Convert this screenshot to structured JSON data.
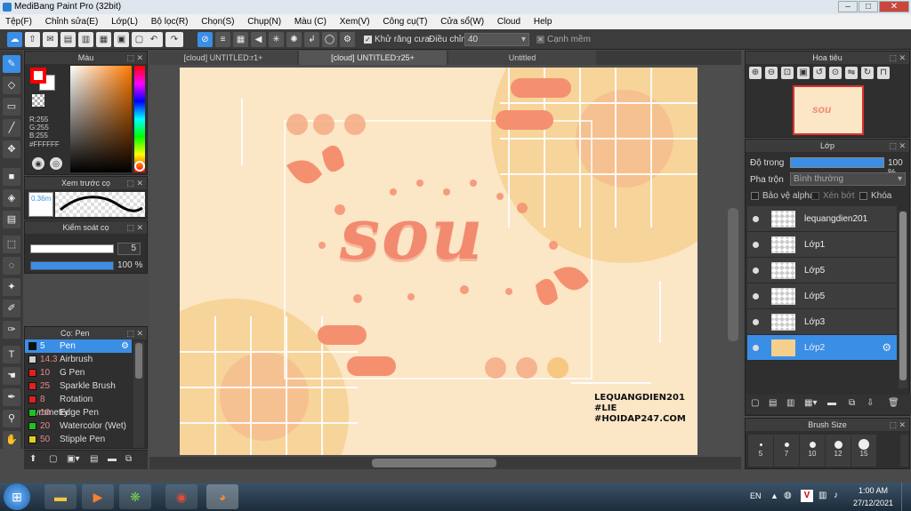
{
  "window": {
    "title": "MediBang Paint Pro (32bit)"
  },
  "menu": [
    "Tệp(F)",
    "Chỉnh sửa(E)",
    "Lớp(L)",
    "Bộ lọc(R)",
    "Chọn(S)",
    "Chụp(N)",
    "Màu (C)",
    "Xem(V)",
    "Công cụ(T)",
    "Cửa sổ(W)",
    "Cloud",
    "Help"
  ],
  "toolbar": {
    "antialias_label": "Khử răng cưa",
    "adjust_label": "Điều chỉnh",
    "adjust_value": "40",
    "sharp_label": "Cạnh mềm"
  },
  "tabs": [
    "[cloud] UNTITLED:r1+",
    "[cloud] UNTITLED:r25+",
    "Untitled"
  ],
  "color_panel": {
    "title": "Màu",
    "r": "R:255",
    "g": "G:255",
    "b": "B:255",
    "hex": "#FFFFFF",
    "primary": "#ff0000",
    "secondary": "#ffffff"
  },
  "preview_panel": {
    "title": "Xem trước cọ",
    "size": "0.36m"
  },
  "brush_control": {
    "title": "Kiểm soát cọ",
    "size": "5",
    "opacity": "100 %"
  },
  "brush_panel": {
    "title": "Cọ: Pen",
    "items": [
      {
        "size": "5",
        "name": "Pen",
        "color": "#111111"
      },
      {
        "size": "14.3",
        "name": "Airbrush",
        "color": "#cfcfcf"
      },
      {
        "size": "10",
        "name": "G Pen",
        "color": "#e02020"
      },
      {
        "size": "25",
        "name": "Sparkle Brush",
        "color": "#e02020"
      },
      {
        "size": "8",
        "name": "Rotation Symmetry",
        "color": "#e02020"
      },
      {
        "size": "10",
        "name": "Edge Pen",
        "color": "#20c020"
      },
      {
        "size": "20",
        "name": "Watercolor (Wet)",
        "color": "#20c020"
      },
      {
        "size": "50",
        "name": "Stipple Pen",
        "color": "#e0d020"
      }
    ]
  },
  "navigator": {
    "title": "Hoa tiêu"
  },
  "layer_panel": {
    "title": "Lớp",
    "opacity_label": "Độ trong",
    "opacity_value": "100 %",
    "opacity_fraction": 1.0,
    "blend_label": "Pha trộn",
    "blend_value": "Bình thường",
    "protect_alpha": "Bảo vệ alpha",
    "clip": "Xén bớt",
    "lock": "Khóa",
    "layers": [
      {
        "name": "lequangdien201"
      },
      {
        "name": "Lớp1"
      },
      {
        "name": "Lớp5"
      },
      {
        "name": "Lớp5"
      },
      {
        "name": "Lớp3"
      },
      {
        "name": "Lớp2"
      }
    ]
  },
  "brush_size": {
    "title": "Brush Size",
    "sizes": [
      "5",
      "7",
      "10",
      "12",
      "15"
    ]
  },
  "canvas": {
    "art_text": "sou",
    "watermark": [
      "LEQUANGDIEN201",
      "#LIE",
      "#HOIDAP247.COM"
    ],
    "colors": {
      "bg": "#fbe6c6",
      "accent": "#f49070",
      "pale": "#f6cf8e"
    }
  },
  "taskbar": {
    "lang": "EN",
    "time": "1:00 AM",
    "date": "27/12/2021"
  }
}
